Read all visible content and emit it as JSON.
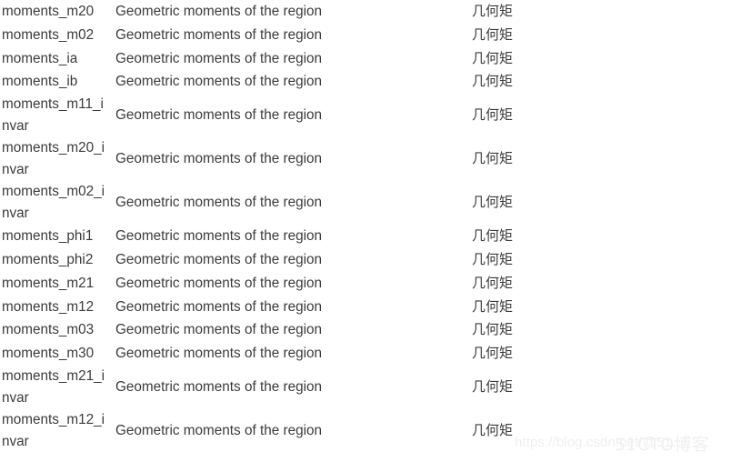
{
  "table": {
    "columns": [
      "name",
      "description_en",
      "description_zh"
    ],
    "rows": [
      {
        "name": "moments_m20",
        "description_en": "Geometric moments of the region",
        "description_zh": "几何矩",
        "wrapped": false
      },
      {
        "name": "moments_m02",
        "description_en": "Geometric moments of the region",
        "description_zh": "几何矩",
        "wrapped": false
      },
      {
        "name": "moments_ia",
        "description_en": "Geometric moments of the region",
        "description_zh": "几何矩",
        "wrapped": false
      },
      {
        "name": "moments_ib",
        "description_en": "Geometric moments of the region",
        "description_zh": "几何矩",
        "wrapped": false
      },
      {
        "name": "moments_m11_invar",
        "description_en": "Geometric moments of the region",
        "description_zh": "几何矩",
        "wrapped": true
      },
      {
        "name": "moments_m20_invar",
        "description_en": "Geometric moments of the region",
        "description_zh": "几何矩",
        "wrapped": true
      },
      {
        "name": "moments_m02_invar",
        "description_en": "Geometric moments of the region",
        "description_zh": "几何矩",
        "wrapped": true
      },
      {
        "name": "moments_phi1",
        "description_en": "Geometric moments of the region",
        "description_zh": "几何矩",
        "wrapped": false
      },
      {
        "name": "moments_phi2",
        "description_en": "Geometric moments of the region",
        "description_zh": "几何矩",
        "wrapped": false
      },
      {
        "name": "moments_m21",
        "description_en": "Geometric moments of the region",
        "description_zh": "几何矩",
        "wrapped": false
      },
      {
        "name": "moments_m12",
        "description_en": "Geometric moments of the region",
        "description_zh": "几何矩",
        "wrapped": false
      },
      {
        "name": "moments_m03",
        "description_en": "Geometric moments of the region",
        "description_zh": "几何矩",
        "wrapped": false
      },
      {
        "name": "moments_m30",
        "description_en": "Geometric moments of the region",
        "description_zh": "几何矩",
        "wrapped": false
      },
      {
        "name": "moments_m21_invar",
        "description_en": "Geometric moments of the region",
        "description_zh": "几何矩",
        "wrapped": true
      },
      {
        "name": "moments_m12_invar",
        "description_en": "Geometric moments of the region",
        "description_zh": "几何矩",
        "wrapped": true
      }
    ]
  },
  "watermarks": {
    "url": "https://blog.csdn.net/@51…",
    "brand": "51CTO博客"
  },
  "colors": {
    "text": "#3b3b3b",
    "background": "#ffffff",
    "watermark": "#efefef"
  }
}
